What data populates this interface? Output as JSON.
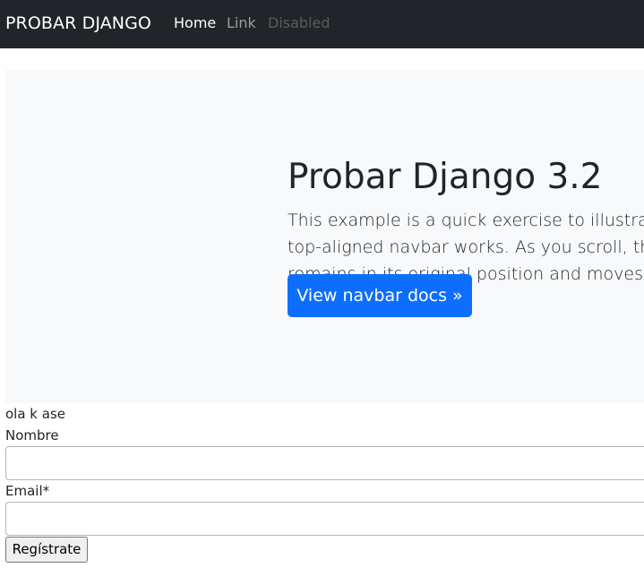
{
  "navbar": {
    "brand": "PROBAR DJANGO",
    "items": [
      {
        "label": "Home",
        "state": "active"
      },
      {
        "label": "Link",
        "state": "normal"
      },
      {
        "label": "Disabled",
        "state": "disabled"
      }
    ]
  },
  "hero": {
    "title": "Probar Django 3.2",
    "lead": "This example is a quick exercise to illustrate how the top-aligned navbar works. As you scroll, this navbar remains in its original position and moves with the rest of the page.",
    "button_label": "View navbar docs »",
    "button_color": "#0d6efd",
    "background": "#f8f9fa"
  },
  "form": {
    "greeting": "ola k ase",
    "nombre_label": "Nombre",
    "nombre_value": "",
    "email_label": "Email*",
    "email_value": "",
    "submit_label": "Regístrate"
  },
  "colors": {
    "navbar_bg": "#212529",
    "text": "#212529"
  }
}
